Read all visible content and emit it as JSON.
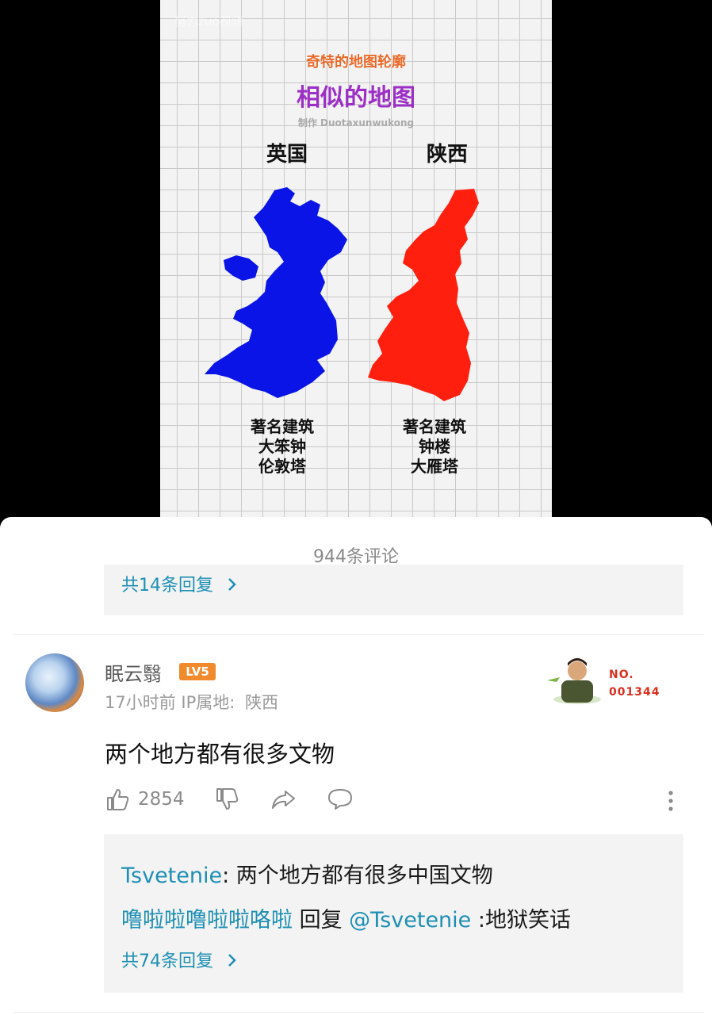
{
  "video": {
    "watermark": "努力zuo视频",
    "tag": "奇特的地图轮廓",
    "title": "相似的地图",
    "credit": "制作 Duotaxunwukong",
    "left": {
      "country": "英国",
      "famous_label": "著名建筑",
      "landmarks": [
        "大笨钟",
        "伦敦塔"
      ],
      "map_color": "#0a14e6"
    },
    "right": {
      "country": "陕西",
      "famous_label": "著名建筑",
      "landmarks": [
        "钟楼",
        "大雁塔"
      ],
      "map_color": "#ff1f0f"
    }
  },
  "comments": {
    "count_label": "944条评论",
    "prev_thread_more": "共14条回复",
    "comment": {
      "username": "眠云翳",
      "level_badge": "LV5",
      "time": "17小时前",
      "ip_label": "IP属地:",
      "ip_value": "陕西",
      "decoration_no_label": "NO.",
      "decoration_no_value": "001344",
      "text": "两个地方都有很多文物",
      "likes": "2854",
      "icons": [
        "thumbs-up-icon",
        "thumbs-down-icon",
        "share-icon",
        "reply-bubble-icon",
        "more-vertical-icon"
      ],
      "replies": [
        {
          "user": "Tsvetenie",
          "sep": ":",
          "text": " 两个地方都有很多中国文物"
        },
        {
          "user": "噜啦啦噜啦啦咯啦",
          "reply_word": " 回复 ",
          "mention": "@Tsvetenie",
          "text": " :地狱笑话"
        }
      ],
      "more_replies": "共74条回复"
    }
  },
  "colors": {
    "link": "#1e8fb4",
    "badge": "#f08a2c",
    "title_purple": "#9b2fc6"
  }
}
